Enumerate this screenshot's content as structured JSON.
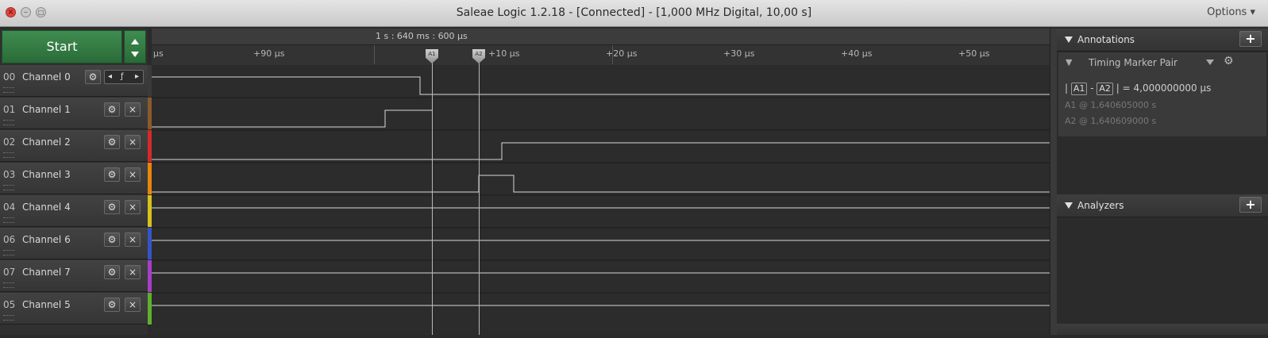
{
  "window": {
    "title": "Saleae Logic 1.2.18 - [Connected] - [1,000 MHz Digital, 10,00 s]",
    "options_label": "Options ▾"
  },
  "start_button": {
    "label": "Start"
  },
  "timeline": {
    "absolute_time": "1 s : 640 ms : 600 µs",
    "ticks": [
      "µs",
      "+90 µs",
      "+10 µs",
      "+20 µs",
      "+30 µs",
      "+40 µs",
      "+50 µs"
    ]
  },
  "markers": {
    "a1_label": "A1",
    "a2_label": "A2"
  },
  "channels": [
    {
      "num": "00",
      "name": "Channel 0",
      "color": "#3a3a3a"
    },
    {
      "num": "01",
      "name": "Channel 1",
      "color": "#8b5a2b"
    },
    {
      "num": "02",
      "name": "Channel 2",
      "color": "#d42a2a"
    },
    {
      "num": "03",
      "name": "Channel 3",
      "color": "#e8860e"
    },
    {
      "num": "04",
      "name": "Channel 4",
      "color": "#d9c21a"
    },
    {
      "num": "06",
      "name": "Channel 6",
      "color": "#3355c8"
    },
    {
      "num": "07",
      "name": "Channel 7",
      "color": "#a73fc4"
    },
    {
      "num": "05",
      "name": "Channel 5",
      "color": "#5fb02e"
    }
  ],
  "channel0_trigger": {
    "left": "◂",
    "edge": "ƒ",
    "right": "▸"
  },
  "annotations": {
    "title": "Annotations",
    "add": "+",
    "marker_pair": "Timing Marker Pair",
    "diff_prefix": "|",
    "a1": "A1",
    "dash": "-",
    "a2": "A2",
    "diff_suffix": "| =  4,000000000 µs",
    "a1_line": "A1   @   1,640605000 s",
    "a2_line": "A2   @   1,640609000 s"
  },
  "analyzers": {
    "title": "Analyzers",
    "add": "+"
  }
}
